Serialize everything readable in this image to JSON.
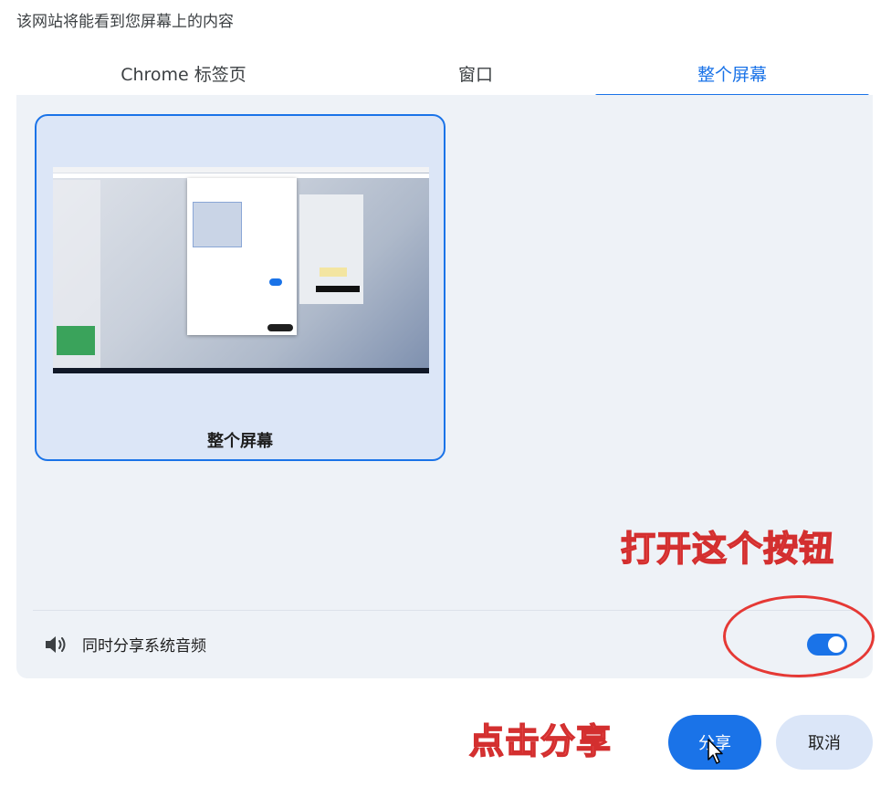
{
  "dialog": {
    "title": "该网站将能看到您屏幕上的内容"
  },
  "tabs": [
    {
      "label": "Chrome 标签页",
      "selected": false
    },
    {
      "label": "窗口",
      "selected": false
    },
    {
      "label": "整个屏幕",
      "selected": true
    }
  ],
  "screen_card": {
    "label": "整个屏幕",
    "selected": true
  },
  "audio": {
    "icon": "speaker-icon",
    "label": "同时分享系统音频",
    "enabled": true
  },
  "annotations": {
    "toggle_hint": "打开这个按钮",
    "share_hint": "点击分享"
  },
  "buttons": {
    "share": "分享",
    "cancel": "取消"
  },
  "colors": {
    "accent": "#1a73e8",
    "panel": "#eef2f7",
    "annotation": "#e53935"
  }
}
